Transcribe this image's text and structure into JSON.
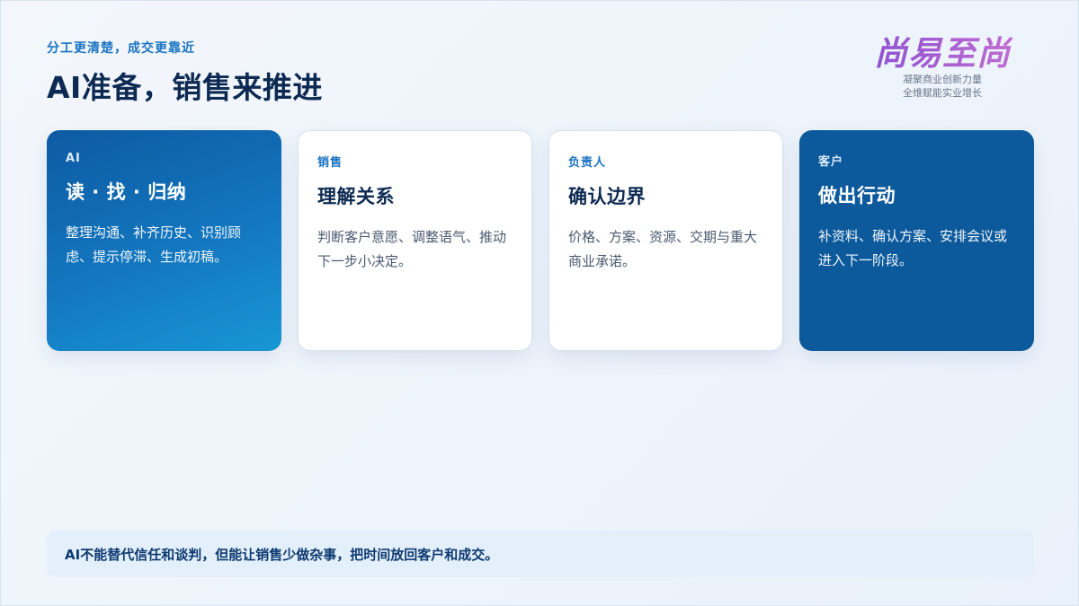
{
  "header": {
    "eyebrow": "分工更清楚，成交更靠近",
    "title": "AI准备，销售来推进"
  },
  "brand": {
    "logo": "尚易至尚",
    "tagline_1": "凝聚商业创新力量",
    "tagline_2": "全维赋能实业增长"
  },
  "cards": [
    {
      "tag": "AI",
      "title": "读 · 找 · 归纳",
      "desc": "整理沟通、补齐历史、识别顾虑、提示停滞、生成初稿。"
    },
    {
      "tag": "销售",
      "title": "理解关系",
      "desc": "判断客户意愿、调整语气、推动下一步小决定。"
    },
    {
      "tag": "负责人",
      "title": "确认边界",
      "desc": "价格、方案、资源、交期与重大商业承诺。"
    },
    {
      "tag": "客户",
      "title": "做出行动",
      "desc": "补资料、确认方案、安排会议或进入下一阶段。"
    }
  ],
  "footer": {
    "text": "AI不能替代信任和谈判，但能让销售少做杂事，把时间放回客户和成交。"
  },
  "colors": {
    "accent": "#1a73c2",
    "title": "#0d2a52",
    "card_dark": "#0c5a9b",
    "brand": "#a25cd0"
  }
}
